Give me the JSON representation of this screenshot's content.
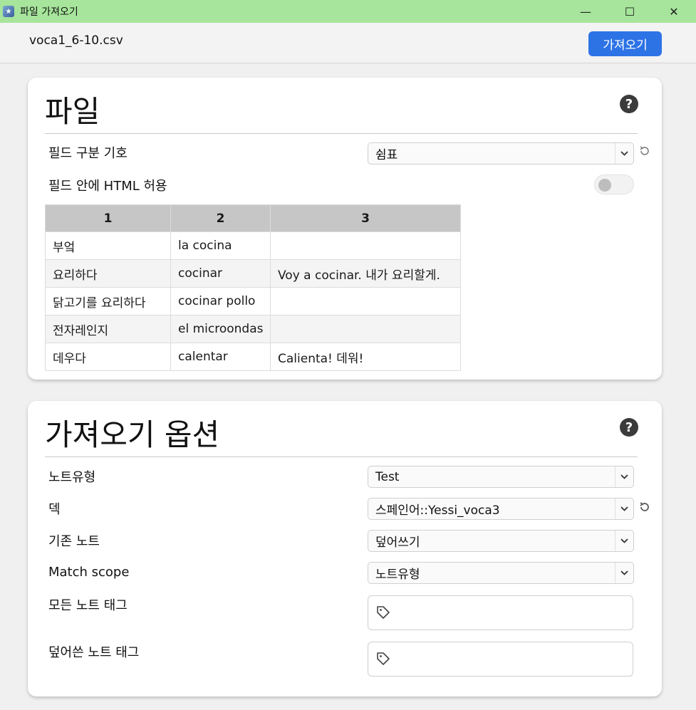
{
  "window": {
    "title": "파일 가져오기",
    "controls": {
      "minimize": "—",
      "maximize": "☐",
      "close": "✕"
    }
  },
  "topbar": {
    "filename": "voca1_6-10.csv",
    "import_label": "가져오기"
  },
  "file_section": {
    "title": "파일",
    "help": "?",
    "separator_label": "필드 구분 기호",
    "separator_value": "쉼표",
    "html_label": "필드 안에 HTML 허용",
    "html_enabled": false,
    "table": {
      "headers": [
        "1",
        "2",
        "3"
      ],
      "rows": [
        [
          "부엌",
          "la cocina",
          ""
        ],
        [
          "요리하다",
          "cocinar",
          "Voy a cocinar. 내가 요리할게."
        ],
        [
          "닭고기를 요리하다",
          "cocinar pollo",
          ""
        ],
        [
          "전자레인지",
          "el microondas",
          ""
        ],
        [
          "데우다",
          "calentar",
          "Calienta! 데워!"
        ]
      ]
    }
  },
  "import_options": {
    "title": "가져오기 옵션",
    "help": "?",
    "notetype_label": "노트유형",
    "notetype_value": "Test",
    "deck_label": "덱",
    "deck_value": "스페인어::Yessi_voca3",
    "existing_label": "기존 노트",
    "existing_value": "덮어쓰기",
    "scope_label": "Match scope",
    "scope_value": "노트유형",
    "all_tags_label": "모든 노트 태그",
    "updated_tags_label": "덮어쓴 노트 태그"
  },
  "icons": {
    "chevron": "chevron-down-icon",
    "reset": "reset-icon",
    "tag": "tag-icon",
    "help": "help-icon"
  },
  "colors": {
    "titlebar": "#a6e59b",
    "accent": "#2d73e6"
  }
}
